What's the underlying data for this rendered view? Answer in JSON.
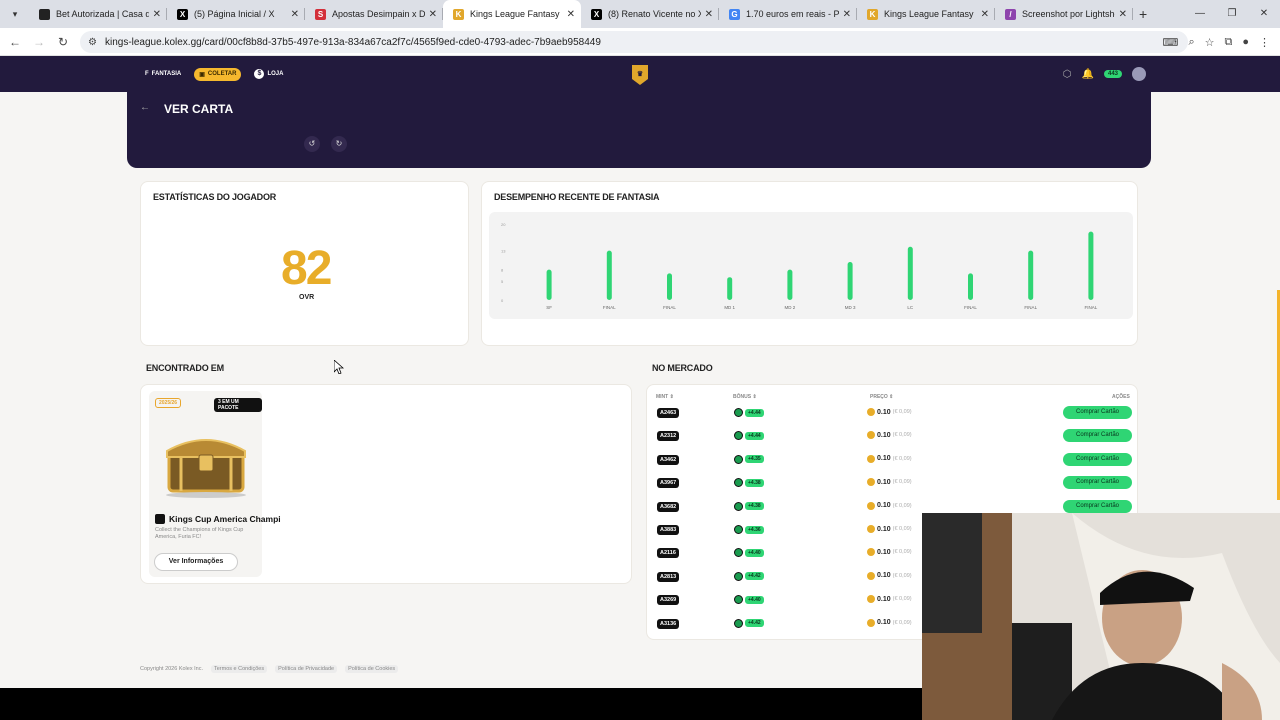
{
  "browser": {
    "tabs": [
      {
        "title": "Bet Autorizada | Casa de",
        "fav_color": "#222",
        "fav_glyph": ""
      },
      {
        "title": "(5) Página Inicial / X",
        "fav_color": "#000",
        "fav_glyph": "X"
      },
      {
        "title": "Apostas Desimpain x Dib",
        "fav_color": "#d32f3a",
        "fav_glyph": "S"
      },
      {
        "title": "Kings League Fantasy",
        "fav_color": "#e1a72b",
        "fav_glyph": "K",
        "active": true
      },
      {
        "title": "(8) Renato Vicente no X:",
        "fav_color": "#000",
        "fav_glyph": "X"
      },
      {
        "title": "1.70 euros em reais - Pes",
        "fav_color": "#4285f4",
        "fav_glyph": "G"
      },
      {
        "title": "Kings League Fantasy",
        "fav_color": "#e1a72b",
        "fav_glyph": "K"
      },
      {
        "title": "Screenshot por Lightshot",
        "fav_color": "#8e44ad",
        "fav_glyph": "/"
      }
    ],
    "url": "kings-league.kolex.gg/card/00cf8b8d-37b5-497e-913a-834a67ca2f7c/4565f9ed-cde0-4793-adec-7b9aeb958449"
  },
  "nav": {
    "items": [
      "FANTASIA",
      "COLETAR",
      "LOJA"
    ],
    "selected": "COLETAR",
    "notif_badge": "443"
  },
  "hero": {
    "back": "←",
    "title": "VER CARTA"
  },
  "stats": {
    "title": "ESTATÍSTICAS DO JOGADOR",
    "ovr_value": "82",
    "ovr_label": "OVR"
  },
  "performance": {
    "title": "DESEMPENHO RECENTE DE FANTASIA"
  },
  "chart_data": {
    "type": "bar",
    "title": "DESEMPENHO RECENTE DE FANTASIA",
    "categories": [
      "SF",
      "FINAL",
      "FINAL",
      "MD 1",
      "MD 2",
      "MD 3",
      "LC",
      "FINAL",
      "FINAL",
      "FINAL"
    ],
    "values": [
      8,
      13,
      7,
      6,
      8,
      10,
      14,
      7,
      13,
      18
    ],
    "ylim": [
      0,
      20
    ],
    "yticks": [
      0,
      5,
      8,
      13,
      20
    ],
    "color": "#2fd574",
    "grid": false
  },
  "found": {
    "title": "ENCONTRADO EM",
    "tag_season": "2025/26",
    "tag_count": "3 EM UM PACOTE",
    "pack_name": "Kings Cup America Champi",
    "pack_desc": "Collect the Champions of Kings Cup America, Furia FC!",
    "info_button": "Ver Informações"
  },
  "market": {
    "title": "NO MERCADO",
    "headers": {
      "mint": "MINT ⇕",
      "bonus": "BÔNUS ⇕",
      "price": "PREÇO ⇕",
      "actions": "AÇÕES"
    },
    "buy_label": "Comprar Cartão",
    "rows": [
      {
        "mint": "A2463",
        "bonus": "+4.44",
        "price": "0.10",
        "eur": "(€ 0,09)"
      },
      {
        "mint": "A2312",
        "bonus": "+4.44",
        "price": "0.10",
        "eur": "(€ 0,09)"
      },
      {
        "mint": "A3462",
        "bonus": "+4.35",
        "price": "0.10",
        "eur": "(€ 0,09)"
      },
      {
        "mint": "A3967",
        "bonus": "+4.38",
        "price": "0.10",
        "eur": "(€ 0,09)"
      },
      {
        "mint": "A3682",
        "bonus": "+4.38",
        "price": "0.10",
        "eur": "(€ 0,09)"
      },
      {
        "mint": "A3883",
        "bonus": "+4.36",
        "price": "0.10",
        "eur": "(€ 0,09)"
      },
      {
        "mint": "A2116",
        "bonus": "+4.40",
        "price": "0.10",
        "eur": "(€ 0,09)"
      },
      {
        "mint": "A2813",
        "bonus": "+4.42",
        "price": "0.10",
        "eur": "(€ 0,09)"
      },
      {
        "mint": "A3269",
        "bonus": "+4.40",
        "price": "0.10",
        "eur": "(€ 0,09)"
      },
      {
        "mint": "A3136",
        "bonus": "+4.42",
        "price": "0.10",
        "eur": "(€ 0,09)"
      }
    ]
  },
  "footer": {
    "copyright": "Copyright 2026 Kolex Inc.",
    "links": [
      "Termos e Condições",
      "Política de Privacidade",
      "Política de Cookies"
    ]
  }
}
